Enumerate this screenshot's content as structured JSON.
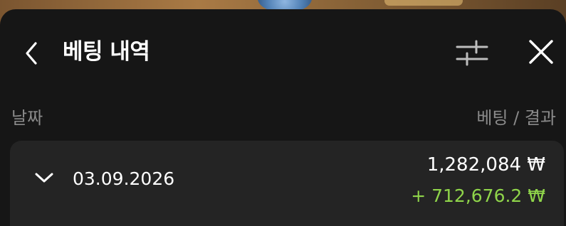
{
  "header": {
    "title": "베팅 내역",
    "back_icon": "chevron-left-icon",
    "filter_icon": "sliders-icon",
    "close_icon": "close-icon"
  },
  "columns": {
    "left": "날짜",
    "right": "베팅 / 결과"
  },
  "rows": [
    {
      "date": "03.09.2026",
      "bet_amount": "1,282,084 ₩",
      "result": "+ 712,676.2 ₩",
      "expand_icon": "chevron-down-icon"
    }
  ],
  "colors": {
    "background": "#161616",
    "card": "#242424",
    "text": "#ffffff",
    "muted": "#8a8a8a",
    "positive": "#8fd44a"
  }
}
